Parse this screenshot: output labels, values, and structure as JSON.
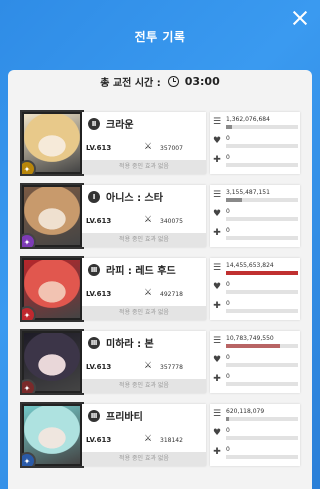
{
  "header": {
    "title": "전투 기록"
  },
  "summary": {
    "label": "총 교전 시간 :",
    "time": "03:00"
  },
  "effect_text": "적용 중인 효과 없음",
  "colors": {
    "damage_top": "#c03030",
    "damage_high": "#b86464",
    "bar_default": "#8a8a8a"
  },
  "characters": [
    {
      "rank": "Ⅱ",
      "name": "크라운",
      "level": "LV.613",
      "power": "357007",
      "damage": "1,362,076,684",
      "damage_fraction": 0.09,
      "taken": "0",
      "heal": "0",
      "burst_icon": "burst-icon"
    },
    {
      "rank": "Ⅰ",
      "name": "아니스 : 스타",
      "level": "LV.613",
      "power": "340075",
      "damage": "3,155,487,151",
      "damage_fraction": 0.22,
      "taken": "0",
      "heal": "0",
      "burst_icon": "burst-icon"
    },
    {
      "rank": "Ⅲ",
      "name": "라피 : 레드 후드",
      "level": "LV.613",
      "power": "492718",
      "damage": "14,455,653,824",
      "damage_fraction": 1.0,
      "taken": "0",
      "heal": "0",
      "burst_icon": "burst-icon"
    },
    {
      "rank": "Ⅲ",
      "name": "미하라 : 본",
      "level": "LV.613",
      "power": "357778",
      "damage": "10,783,749,550",
      "damage_fraction": 0.75,
      "taken": "0",
      "heal": "0",
      "burst_icon": "burst-icon"
    },
    {
      "rank": "Ⅲ",
      "name": "프리바티",
      "level": "LV.613",
      "power": "318142",
      "damage": "620,118,079",
      "damage_fraction": 0.04,
      "taken": "0",
      "heal": "0",
      "burst_icon": "burst-icon"
    }
  ]
}
